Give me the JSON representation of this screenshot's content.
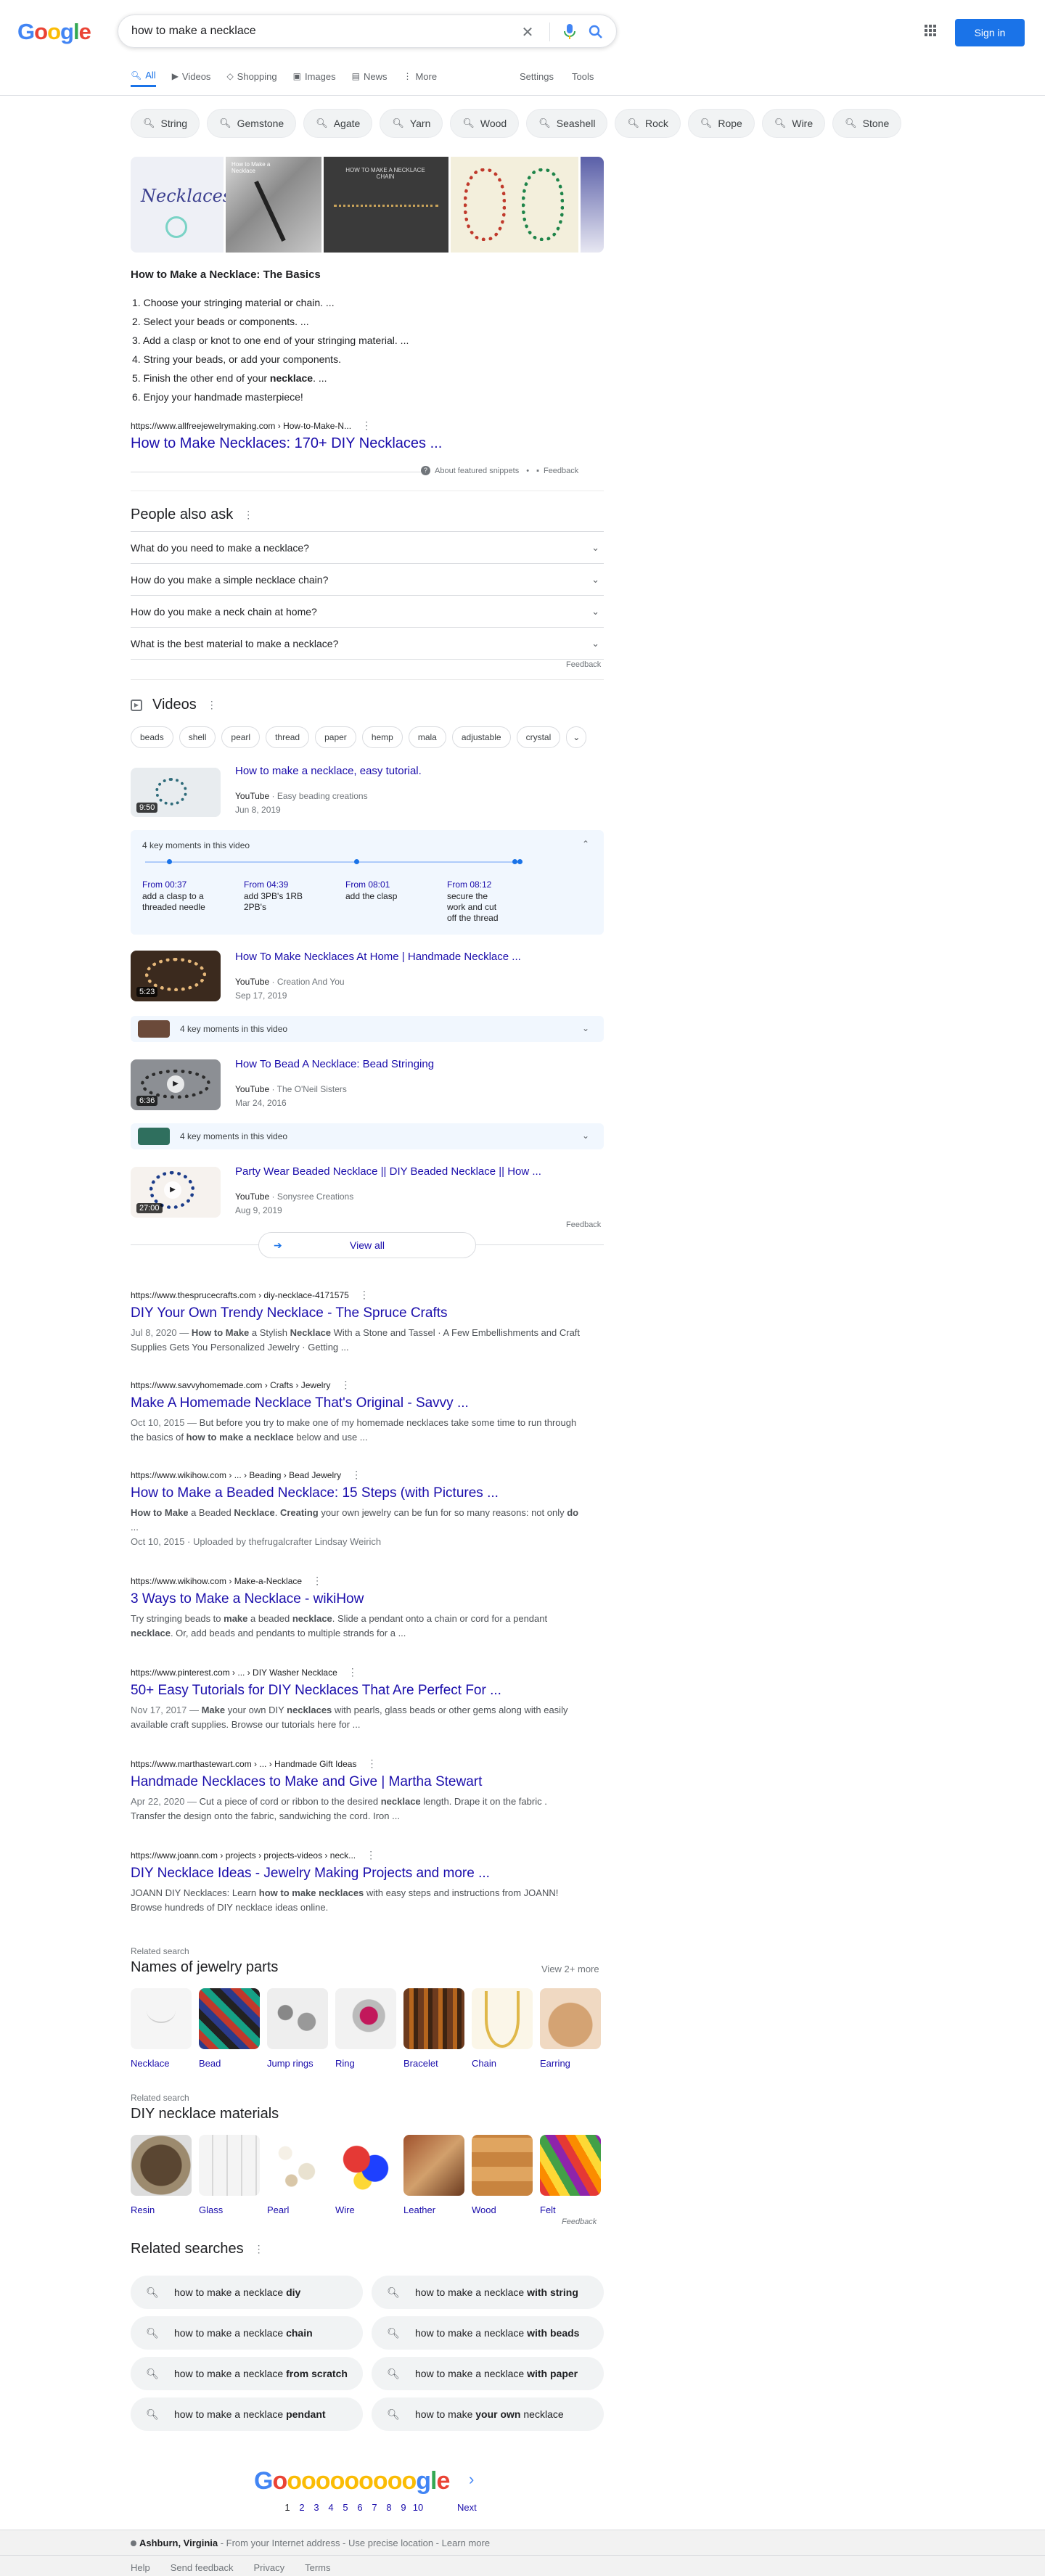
{
  "logo": {
    "letters": [
      "G",
      "o",
      "o",
      "g",
      "l",
      "e"
    ],
    "colors": [
      "#4285f4",
      "#ea4335",
      "#fbbc05",
      "#4285f4",
      "#34a853",
      "#ea4335"
    ]
  },
  "search": {
    "query": "how to make a necklace"
  },
  "header": {
    "sign_in": "Sign in"
  },
  "tabs": [
    {
      "label": "All",
      "icon": "search-icon"
    },
    {
      "label": "Videos",
      "icon": "video-icon"
    },
    {
      "label": "Shopping",
      "icon": "tag-icon"
    },
    {
      "label": "Images",
      "icon": "image-icon"
    },
    {
      "label": "News",
      "icon": "news-icon"
    },
    {
      "label": "More",
      "icon": "more-vert-icon"
    }
  ],
  "tools": {
    "settings": "Settings",
    "tools": "Tools"
  },
  "chips": [
    "String",
    "Gemstone",
    "Agate",
    "Yarn",
    "Wood",
    "Seashell",
    "Rock",
    "Rope",
    "Wire",
    "Stone"
  ],
  "featured": {
    "images": [
      {
        "caption": "Necklaces"
      },
      {
        "caption": "How to Make a Necklace"
      },
      {
        "caption": "HOW TO MAKE A NECKLACE CHAIN"
      },
      {
        "caption": ""
      },
      {
        "caption": ""
      }
    ],
    "title": "How to Make a Necklace: The Basics",
    "steps": [
      {
        "n": "1.",
        "pre": "Choose your stringing material or chain. ...",
        "bold": "",
        "post": ""
      },
      {
        "n": "2.",
        "pre": "Select your beads or components. ...",
        "bold": "",
        "post": ""
      },
      {
        "n": "3.",
        "pre": "Add a clasp or knot to one end of your stringing material. ...",
        "bold": "",
        "post": ""
      },
      {
        "n": "4.",
        "pre": "String your beads, or add your components.",
        "bold": "",
        "post": ""
      },
      {
        "n": "5.",
        "pre": "Finish the other end of your ",
        "bold": "necklace",
        "post": ". ..."
      },
      {
        "n": "6.",
        "pre": "Enjoy your handmade masterpiece!",
        "bold": "",
        "post": ""
      }
    ],
    "url": "https://www.allfreejewelrymaking.com › How-to-Make-N...",
    "link": "How to Make Necklaces: 170+ DIY Necklaces ...",
    "about": "About featured snippets",
    "feedback": "Feedback"
  },
  "paa": {
    "title": "People also ask",
    "questions": [
      "What do you need to make a necklace?",
      "How do you make a simple necklace chain?",
      "How do you make a neck chain at home?",
      "What is the best material to make a necklace?"
    ],
    "feedback": "Feedback"
  },
  "videos": {
    "title": "Videos",
    "chips": [
      "beads",
      "shell",
      "pearl",
      "thread",
      "paper",
      "hemp",
      "mala",
      "adjustable",
      "crystal"
    ],
    "items": [
      {
        "title": "How to make a necklace, easy tutorial.",
        "source": "YouTube",
        "channel": "Easy beading creations",
        "date": "Jun 8, 2019",
        "duration": "9:50"
      },
      {
        "title": "How To Make Necklaces At Home | Handmade Necklace ...",
        "source": "YouTube",
        "channel": "Creation And You",
        "date": "Sep 17, 2019",
        "duration": "5:23"
      },
      {
        "title": "How To Bead A Necklace: Bead Stringing",
        "source": "YouTube",
        "channel": "The O'Neil Sisters",
        "date": "Mar 24, 2016",
        "duration": "6:36"
      },
      {
        "title": "Party Wear Beaded Necklace || DIY Beaded Necklace || How ...",
        "source": "YouTube",
        "channel": "Sonysree Creations",
        "date": "Aug 9, 2019",
        "duration": "27:00"
      }
    ],
    "key_moments_label": "4 key moments in this video",
    "moments": [
      {
        "time": "From 00:37",
        "text": "add a clasp to a threaded needle"
      },
      {
        "time": "From 04:39",
        "text": "add 3PB's 1RB 2PB's"
      },
      {
        "time": "From 08:01",
        "text": "add the clasp"
      },
      {
        "time": "From 08:12",
        "text": "secure the work and cut off the thread"
      }
    ],
    "feedback": "Feedback",
    "view_all": "View all"
  },
  "results": [
    {
      "url": "https://www.thesprucecrafts.com › diy-necklace-4171575",
      "title": "DIY Your Own Trendy Necklace - The Spruce Crafts",
      "date": "Jul 8, 2020 — ",
      "snippet_html": "<b>How to Make</b> a Stylish <b>Necklace</b> With a Stone and Tassel · A Few Embellishments and Craft Supplies Gets You Personalized Jewelry · Getting ..."
    },
    {
      "url": "https://www.savvyhomemade.com › Crafts › Jewelry",
      "title": "Make A Homemade Necklace That's Original - Savvy ...",
      "date": "Oct 10, 2015 — ",
      "snippet_html": "But before you try to make one of my homemade necklaces take some time to run through the basics of <b>how to make a necklace</b> below and use ..."
    },
    {
      "url": "https://www.wikihow.com › ... › Beading › Bead Jewelry",
      "title": "How to Make a Beaded Necklace: 15 Steps (with Pictures ...",
      "date": "",
      "snippet_html": "<b>How to Make</b> a Beaded <b>Necklace</b>. <b>Creating</b> your own jewelry can be fun for so many reasons: not only <b>do</b> ...",
      "extra": "Oct 10, 2015 · Uploaded by thefrugalcrafter Lindsay Weirich"
    },
    {
      "url": "https://www.wikihow.com › Make-a-Necklace",
      "title": "3 Ways to Make a Necklace - wikiHow",
      "date": "",
      "snippet_html": "Try stringing beads to <b>make</b> a beaded <b>necklace</b>. Slide a pendant onto a chain or cord for a pendant <b>necklace</b>. Or, add beads and pendants to multiple strands for a ..."
    },
    {
      "url": "https://www.pinterest.com › ... › DIY Washer Necklace",
      "title": "50+ Easy Tutorials for DIY Necklaces That Are Perfect For ...",
      "date": "Nov 17, 2017 — ",
      "snippet_html": "<b>Make</b> your own DIY <b>necklaces</b> with pearls, glass beads or other gems along with easily available craft supplies. Browse our tutorials here for ..."
    },
    {
      "url": "https://www.marthastewart.com › ... › Handmade Gift Ideas",
      "title": "Handmade Necklaces to Make and Give | Martha Stewart",
      "date": "Apr 22, 2020 — ",
      "snippet_html": "Cut a piece of cord or ribbon to the desired <b>necklace</b> length. Drape it on the fabric . Transfer the design onto the fabric, sandwiching the cord. Iron ..."
    },
    {
      "url": "https://www.joann.com › projects › projects-videos › neck...",
      "title": "DIY Necklace Ideas - Jewelry Making Projects and more ...",
      "date": "",
      "snippet_html": "JOANN DIY Necklaces: Learn <b>how to make necklaces</b> with easy steps and instructions from JOANN! Browse hundreds of DIY necklace ideas online."
    }
  ],
  "related_parts": {
    "kicker": "Related search",
    "title": "Names of jewelry parts",
    "view_more": "View 2+ more",
    "items": [
      "Necklace",
      "Bead",
      "Jump rings",
      "Ring",
      "Bracelet",
      "Chain",
      "Earring"
    ]
  },
  "related_materials": {
    "kicker": "Related search",
    "title": "DIY necklace materials",
    "items": [
      "Resin",
      "Glass",
      "Pearl",
      "Wire",
      "Leather",
      "Wood",
      "Felt"
    ],
    "feedback": "Feedback"
  },
  "related_searches": {
    "title": "Related searches",
    "items": [
      {
        "pre": "how to make a necklace ",
        "bold": "diy",
        "post": ""
      },
      {
        "pre": "how to make a necklace ",
        "bold": "with string",
        "post": ""
      },
      {
        "pre": "how to make a necklace ",
        "bold": "chain",
        "post": ""
      },
      {
        "pre": "how to make a necklace ",
        "bold": "with beads",
        "post": ""
      },
      {
        "pre": "how to make a necklace ",
        "bold": "from scratch",
        "post": ""
      },
      {
        "pre": "how to make a necklace ",
        "bold": "with paper",
        "post": ""
      },
      {
        "pre": "how to make a necklace ",
        "bold": "pendant",
        "post": ""
      },
      {
        "pre": "how to make ",
        "bold": "your own",
        "post": " necklace"
      }
    ]
  },
  "pagination": {
    "pages": [
      "1",
      "2",
      "3",
      "4",
      "5",
      "6",
      "7",
      "8",
      "9",
      "10"
    ],
    "next": "Next",
    "logo_text": "Goooooooooogle"
  },
  "footer": {
    "location": "Ashburn, Virginia",
    "location_note": " - From your Internet address - Use precise location - Learn more",
    "links": [
      "Help",
      "Send feedback",
      "Privacy",
      "Terms"
    ]
  }
}
